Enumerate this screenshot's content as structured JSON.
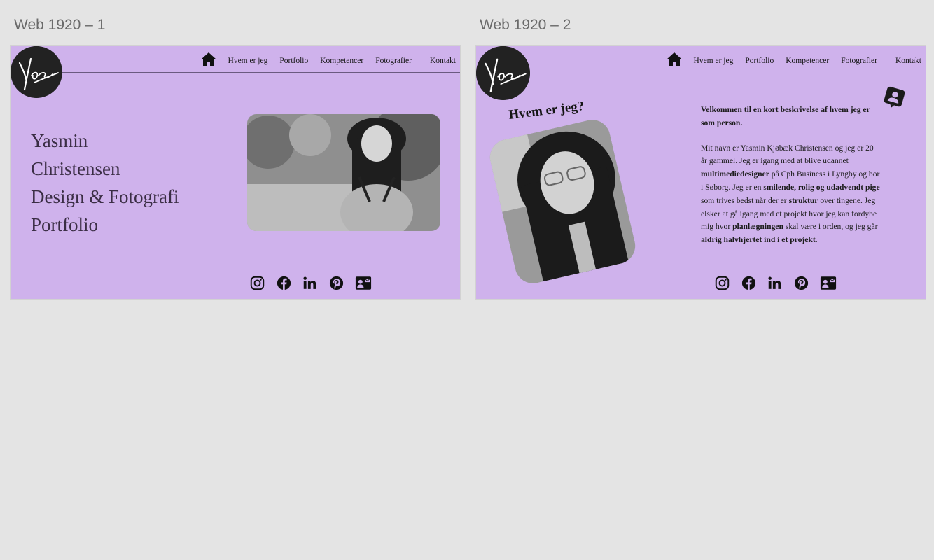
{
  "frames": [
    {
      "label": "Web 1920 – 1",
      "nav": [
        "Hvem er jeg",
        "Portfolio",
        "Kompetencer",
        "Fotografier",
        "Kontakt"
      ],
      "hero_title": [
        "Yasmin",
        "Christensen",
        "Design & Fotografi",
        "Portfolio"
      ]
    },
    {
      "label": "Web 1920 – 2",
      "nav": [
        "Hvem er jeg",
        "Portfolio",
        "Kompetencer",
        "Fotografier",
        "Kontakt"
      ],
      "heading": "Hvem er jeg?",
      "intro": "Velkommen til en kort beskrivelse af hvem jeg er som person.",
      "body_parts": [
        "Mit navn er Yasmin Kjøbæk Christensen og jeg er 20 år gammel. Jeg er igang med at blive udannet ",
        "multimediedesigner",
        " på Cph Business i Lyngby og bor i Søborg. Jeg er en s",
        "milende, rolig og udadvendt pige",
        " som trives bedst når der er ",
        "struktur",
        " over tingene. Jeg elsker at gå igang med et projekt hvor jeg kan fordybe mig hvor ",
        "planlægningen",
        " skal være i orden, og jeg går ",
        "aldrig halvhjertet ind i et projekt",
        "."
      ]
    }
  ],
  "social_icons": [
    "instagram-icon",
    "facebook-icon",
    "linkedin-icon",
    "pinterest-icon",
    "contact-card-icon"
  ],
  "logo_text": "Yas",
  "colors": {
    "artboard": "#cfb2ec",
    "canvas": "#e4e4e4",
    "logo": "#222222",
    "text": "#151515"
  }
}
